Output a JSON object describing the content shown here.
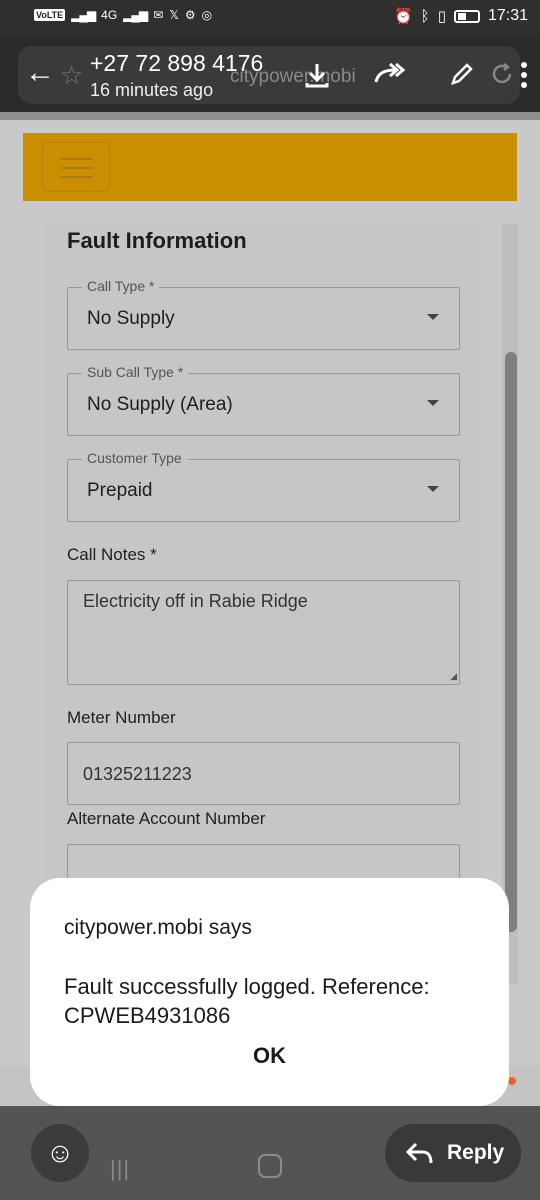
{
  "status_bar": {
    "volte": "VoLTE",
    "network": "4G",
    "time": "17:31"
  },
  "viewer": {
    "sender": "+27 72 898 4176",
    "time_ago": "16 minutes ago",
    "domain": "citypower.mobi"
  },
  "form": {
    "title": "Fault Information",
    "call_type": {
      "label": "Call Type *",
      "value": "No Supply"
    },
    "sub_call_type": {
      "label": "Sub Call Type *",
      "value": "No Supply (Area)"
    },
    "customer_type": {
      "label": "Customer Type",
      "value": "Prepaid"
    },
    "call_notes": {
      "label": "Call Notes *",
      "value": "Electricity off in Rabie Ridge"
    },
    "meter_number": {
      "label": "Meter Number",
      "value": "01325211223"
    },
    "alternate_account": {
      "label": "Alternate Account Number",
      "value": ""
    }
  },
  "dialog": {
    "title": "citypower.mobi says",
    "message": "Fault successfully logged. Reference: CPWEB4931086",
    "ok_label": "OK"
  },
  "bottom_bar": {
    "reply_label": "Reply",
    "recents_glyph": "|||"
  },
  "colors": {
    "header": "#c98f00",
    "dialog_bg": "#ffffff",
    "notification_dot": "#e8622a"
  }
}
